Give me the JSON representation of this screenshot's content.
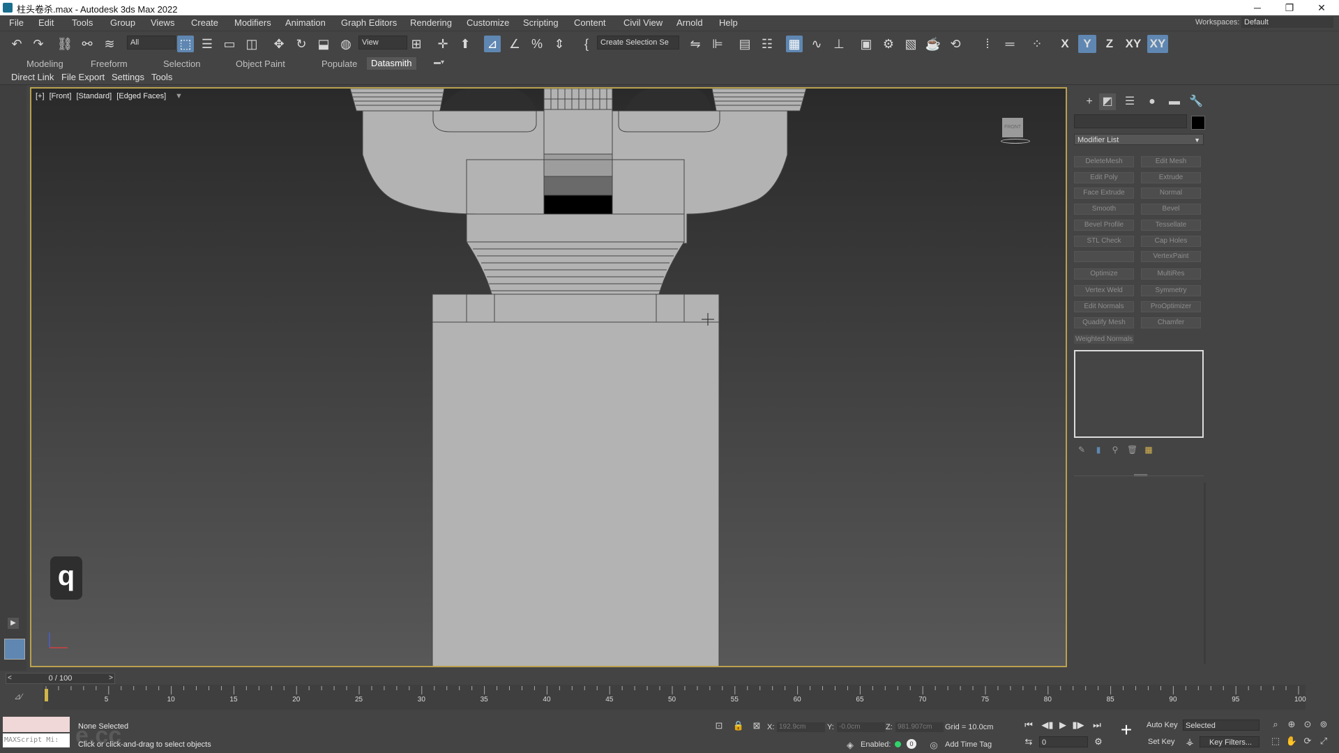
{
  "window": {
    "title": "柱头卷杀.max - Autodesk 3ds Max 2022",
    "minimize": "─",
    "restore": "❐",
    "close": "✕"
  },
  "menu": [
    "File",
    "Edit",
    "Tools",
    "Group",
    "Views",
    "Create",
    "Modifiers",
    "Animation",
    "Graph Editors",
    "Rendering",
    "Customize",
    "Scripting",
    "Content",
    "Civil View",
    "Arnold",
    "Help"
  ],
  "workspace": {
    "label": "Workspaces:",
    "value": "Default"
  },
  "toolbar": {
    "filter_value": "All",
    "refcoord_value": "View",
    "selection_set_placeholder": "Create Selection Se",
    "axes": [
      "X",
      "Y",
      "Z",
      "XY",
      "XY"
    ]
  },
  "ribbon_tabs": [
    "Modeling",
    "Freeform",
    "Selection",
    "Object Paint",
    "Populate",
    "Datasmith"
  ],
  "subribbon_tabs": [
    "Direct Link",
    "File Export",
    "Settings",
    "Tools"
  ],
  "viewport": {
    "labels": [
      "[+]",
      "[Front]",
      "[Standard]",
      "[Edged Faces]"
    ],
    "key_hint": "q",
    "viewcube_text": "FRONT"
  },
  "command_panel": {
    "modifier_list": "Modifier List",
    "modifiers": [
      [
        "DeleteMesh",
        "Edit Mesh"
      ],
      [
        "Edit Poly",
        "Extrude"
      ],
      [
        "Face Extrude",
        "Normal"
      ],
      [
        "Smooth",
        "Bevel"
      ],
      [
        "Bevel Profile",
        "Tessellate"
      ],
      [
        "STL Check",
        "Cap Holes"
      ],
      [
        "",
        "VertexPaint"
      ],
      [
        "Optimize",
        "MultiRes"
      ],
      [
        "Vertex Weld",
        "Symmetry"
      ],
      [
        "Edit Normals",
        "ProOptimizer"
      ],
      [
        "Quadify Mesh",
        "Chamfer"
      ]
    ],
    "weighted_normals": "Weighted Normals",
    "handle": "═══"
  },
  "timeline": {
    "slider_text": "0 / 100",
    "ticks": [
      "5",
      "10",
      "15",
      "20",
      "25",
      "30",
      "35",
      "40",
      "45",
      "50",
      "55",
      "60",
      "65",
      "70",
      "75",
      "80",
      "85",
      "90",
      "95",
      "100"
    ],
    "playhead_frame": 0
  },
  "status": {
    "maxscript_placeholder": "MAXScript Mi:",
    "watermark": "e.cc",
    "selection": "None Selected",
    "prompt": "Click or click-and-drag to select objects",
    "x_label": "X:",
    "x_value": "192.9cm",
    "y_label": "Y:",
    "y_value": "-0.0cm",
    "z_label": "Z:",
    "z_value": "981.907cm",
    "grid": "Grid = 10.0cm",
    "enabled": "Enabled:",
    "enabled_value": "0",
    "add_time_tag": "Add Time Tag",
    "auto_key": "Auto Key",
    "set_key": "Set Key",
    "selected": "Selected",
    "key_filters": "Key Filters...",
    "frame_value": "0"
  },
  "colors": {
    "accent": "#5f87b2",
    "viewport_border": "#b9a14e",
    "model_fill": "#b3b3b3",
    "enabled_dot": "#31d36b"
  }
}
